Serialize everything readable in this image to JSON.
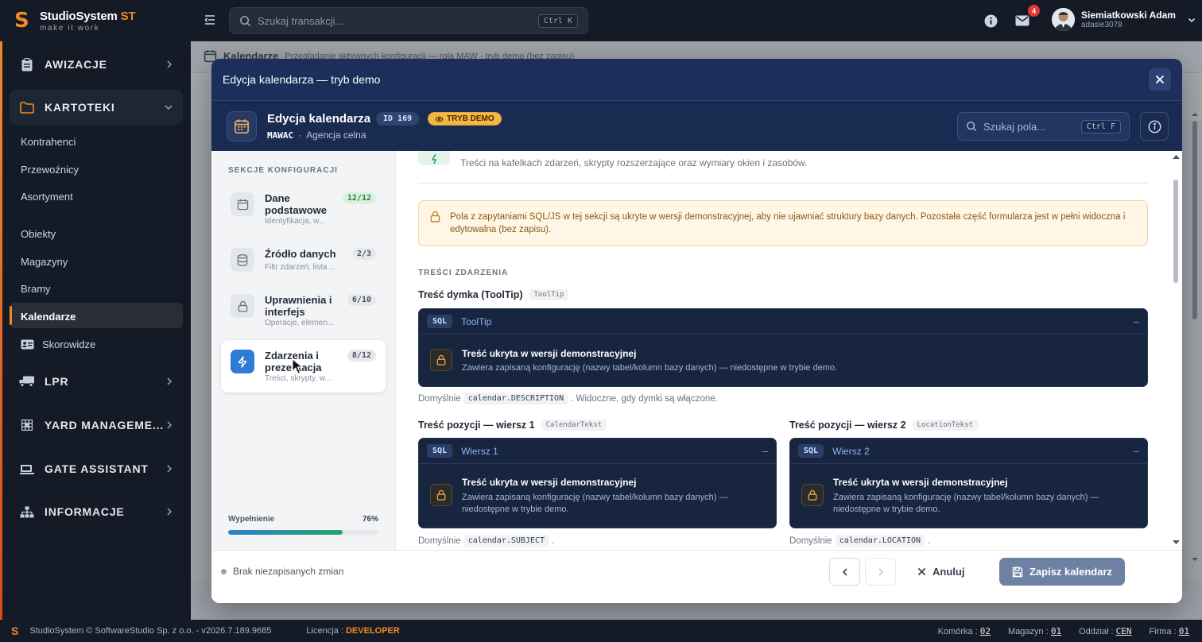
{
  "app": {
    "name": "StudioSystem",
    "name_suffix": "ST",
    "tagline": "make it work",
    "accent": "#f08a24"
  },
  "topbar": {
    "search_placeholder": "Szukaj transakcji...",
    "search_shortcut": "Ctrl K",
    "notifications_count": "4",
    "user_name": "Siemiatkowski Adam",
    "user_login": "adasie3078"
  },
  "sidebar": {
    "groups": [
      {
        "label": "AWIZACJE",
        "icon": "clipboard-icon"
      },
      {
        "label": "KARTOTEKI",
        "icon": "folder-icon"
      },
      {
        "label": "LPR",
        "icon": "truck-icon"
      },
      {
        "label": "YARD MANAGEME...",
        "icon": "grid-icon"
      },
      {
        "label": "GATE ASSISTANT",
        "icon": "gate-icon"
      },
      {
        "label": "INFORMACJE",
        "icon": "sitemap-icon"
      }
    ],
    "items": [
      "Kontrahenci",
      "Przewoźnicy",
      "Asortyment",
      "Obiekty",
      "Magazyny",
      "Bramy",
      "Kalendarze",
      "Skorowidze"
    ]
  },
  "background": {
    "title": "Kalendarze",
    "subtitle": "Przeglądanie aktywnych konfiguracji — rola MAW · tryb demo (bez zapisu)"
  },
  "modal": {
    "title": "Edycja kalendarza — tryb demo",
    "header": {
      "title": "Edycja kalendarza",
      "id_badge": "ID 169",
      "demo_badge": "TRYB DEMO",
      "code": "MAWAC",
      "separator": "·",
      "subtitle": "Agencja celna",
      "search_placeholder": "Szukaj pola...",
      "search_shortcut": "Ctrl F"
    },
    "sections_label": "SEKCJE KONFIGURACJI",
    "sections": [
      {
        "title": "Dane podstawowe",
        "desc": "Identyfikacja, w...",
        "count": "12/12"
      },
      {
        "title": "Źródło danych",
        "desc": "Filtr zdarzeń, lista ...",
        "count": "2/3"
      },
      {
        "title": "Uprawnienia i interfejs",
        "desc": "Operacje, elemen...",
        "count": "6/10"
      },
      {
        "title": "Zdarzenia i prezentacja",
        "desc": "Treści, skrypty, w...",
        "count": "8/12"
      }
    ],
    "fill": {
      "label": "Wypełnienie",
      "value": "76%",
      "fraction": 0.76
    },
    "content": {
      "section_desc": "Treści na kafelkach zdarzeń, skrypty rozszerzające oraz wymiary okien i zasobów.",
      "warning": "Pola z zapytaniami SQL/JS w tej sekcji są ukryte w wersji demonstracyjnej, aby nie ujawniać struktury bazy danych. Pozostała część formularza jest w pełni widoczna i edytowalna (bez zapisu).",
      "group_label": "TREŚCI ZDARZENIA",
      "fields": [
        {
          "label": "Treść dymka (ToolTip)",
          "chip": "ToolTip",
          "sql_tag": "SQL",
          "sql_name": "ToolTip",
          "hint_before": "Domyślnie",
          "hint_code": "calendar.DESCRIPTION",
          "hint_after": ". Widoczne, gdy dymki są włączone."
        },
        {
          "label": "Treść pozycji — wiersz 1",
          "chip": "CalendarTekst",
          "sql_tag": "SQL",
          "sql_name": "Wiersz 1",
          "hint_before": "Domyślnie",
          "hint_code": "calendar.SUBJECT",
          "hint_after": "."
        },
        {
          "label": "Treść pozycji — wiersz 2",
          "chip": "LocationTekst",
          "sql_tag": "SQL",
          "sql_name": "Wiersz 2",
          "hint_before": "Domyślnie",
          "hint_code": "calendar.LOCATION",
          "hint_after": "."
        }
      ],
      "hidden_title": "Treść ukryta w wersji demonstracyjnej",
      "hidden_desc": "Zawiera zapisaną konfigurację (nazwy tabel/kolumn bazy danych) — niedostępne w trybie demo.",
      "minimize": "–"
    },
    "footer": {
      "unsaved": "Brak niezapisanych zmian",
      "cancel": "Anuluj",
      "save": "Zapisz kalendarz"
    }
  },
  "statusbar": {
    "copyright": "StudioSystem © SoftwareStudio Sp. z o.o. - v2026.7.189.9685",
    "license_label": "Licencja :",
    "license_value": "DEVELOPER",
    "komorka_label": "Komórka :",
    "komorka": "02",
    "magazyn_label": "Magazyn :",
    "magazyn": "01",
    "oddzial_label": "Oddział :",
    "oddzial": "CEN",
    "firma_label": "Firma :",
    "firma": "01"
  }
}
